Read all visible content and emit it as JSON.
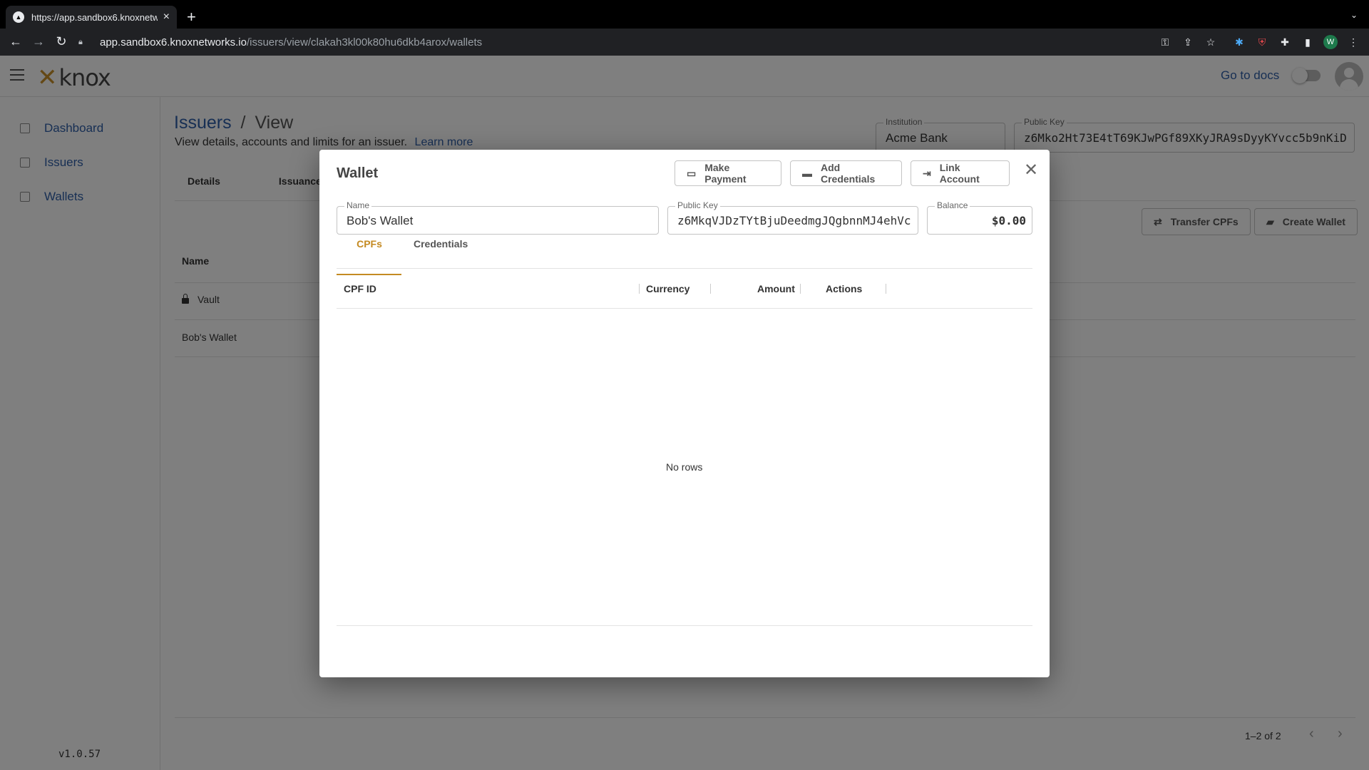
{
  "browser": {
    "tab_title": "https://app.sandbox6.knoxnetw",
    "url_host": "app.sandbox6.knoxnetworks.io",
    "url_path": "/issuers/view/clakah3kl00k80hu6dkb4arox/wallets",
    "profile_initial": "W"
  },
  "header": {
    "logo_text": "knox",
    "docs_link": "Go to docs"
  },
  "sidebar": {
    "items": [
      {
        "label": "Dashboard"
      },
      {
        "label": "Issuers"
      },
      {
        "label": "Wallets"
      }
    ],
    "version": "v1.0.57"
  },
  "page": {
    "breadcrumb_root": "Issuers",
    "breadcrumb_sep": "/",
    "breadcrumb_current": "View",
    "subtitle": "View details, accounts and limits for an issuer.",
    "learn_more": "Learn more",
    "institution_label": "Institution",
    "institution_value": "Acme Bank",
    "public_key_label": "Public Key",
    "public_key_value": "z6Mko2Ht73E4tT69KJwPGf89XKyJRA9sDyyKYvcc5b9nKiD",
    "tabs": [
      {
        "label": "Details"
      },
      {
        "label": "Issuance Limit"
      }
    ],
    "transfer_button": "Transfer CPFs",
    "create_wallet_button": "Create Wallet",
    "table": {
      "name_header": "Name",
      "rows": [
        {
          "name": "Vault"
        },
        {
          "name": "Bob's Wallet"
        }
      ]
    },
    "pager_text": "1–2 of 2"
  },
  "modal": {
    "title": "Wallet",
    "make_payment": "Make Payment",
    "add_credentials": "Add Credentials",
    "link_account": "Link Account",
    "name_label": "Name",
    "name_value": "Bob's Wallet",
    "public_key_label": "Public Key",
    "public_key_value": "z6MkqVJDzTYtBjuDeedmgJQgbnnMJ4ehVc",
    "balance_label": "Balance",
    "balance_value": "$0.00",
    "tabs": [
      {
        "label": "CPFs"
      },
      {
        "label": "Credentials"
      }
    ],
    "columns": {
      "cpf_id": "CPF ID",
      "currency": "Currency",
      "amount": "Amount",
      "actions": "Actions"
    },
    "empty_text": "No rows"
  },
  "colors": {
    "accent_gold": "#c48a22",
    "link_blue": "#2f5fa8"
  }
}
